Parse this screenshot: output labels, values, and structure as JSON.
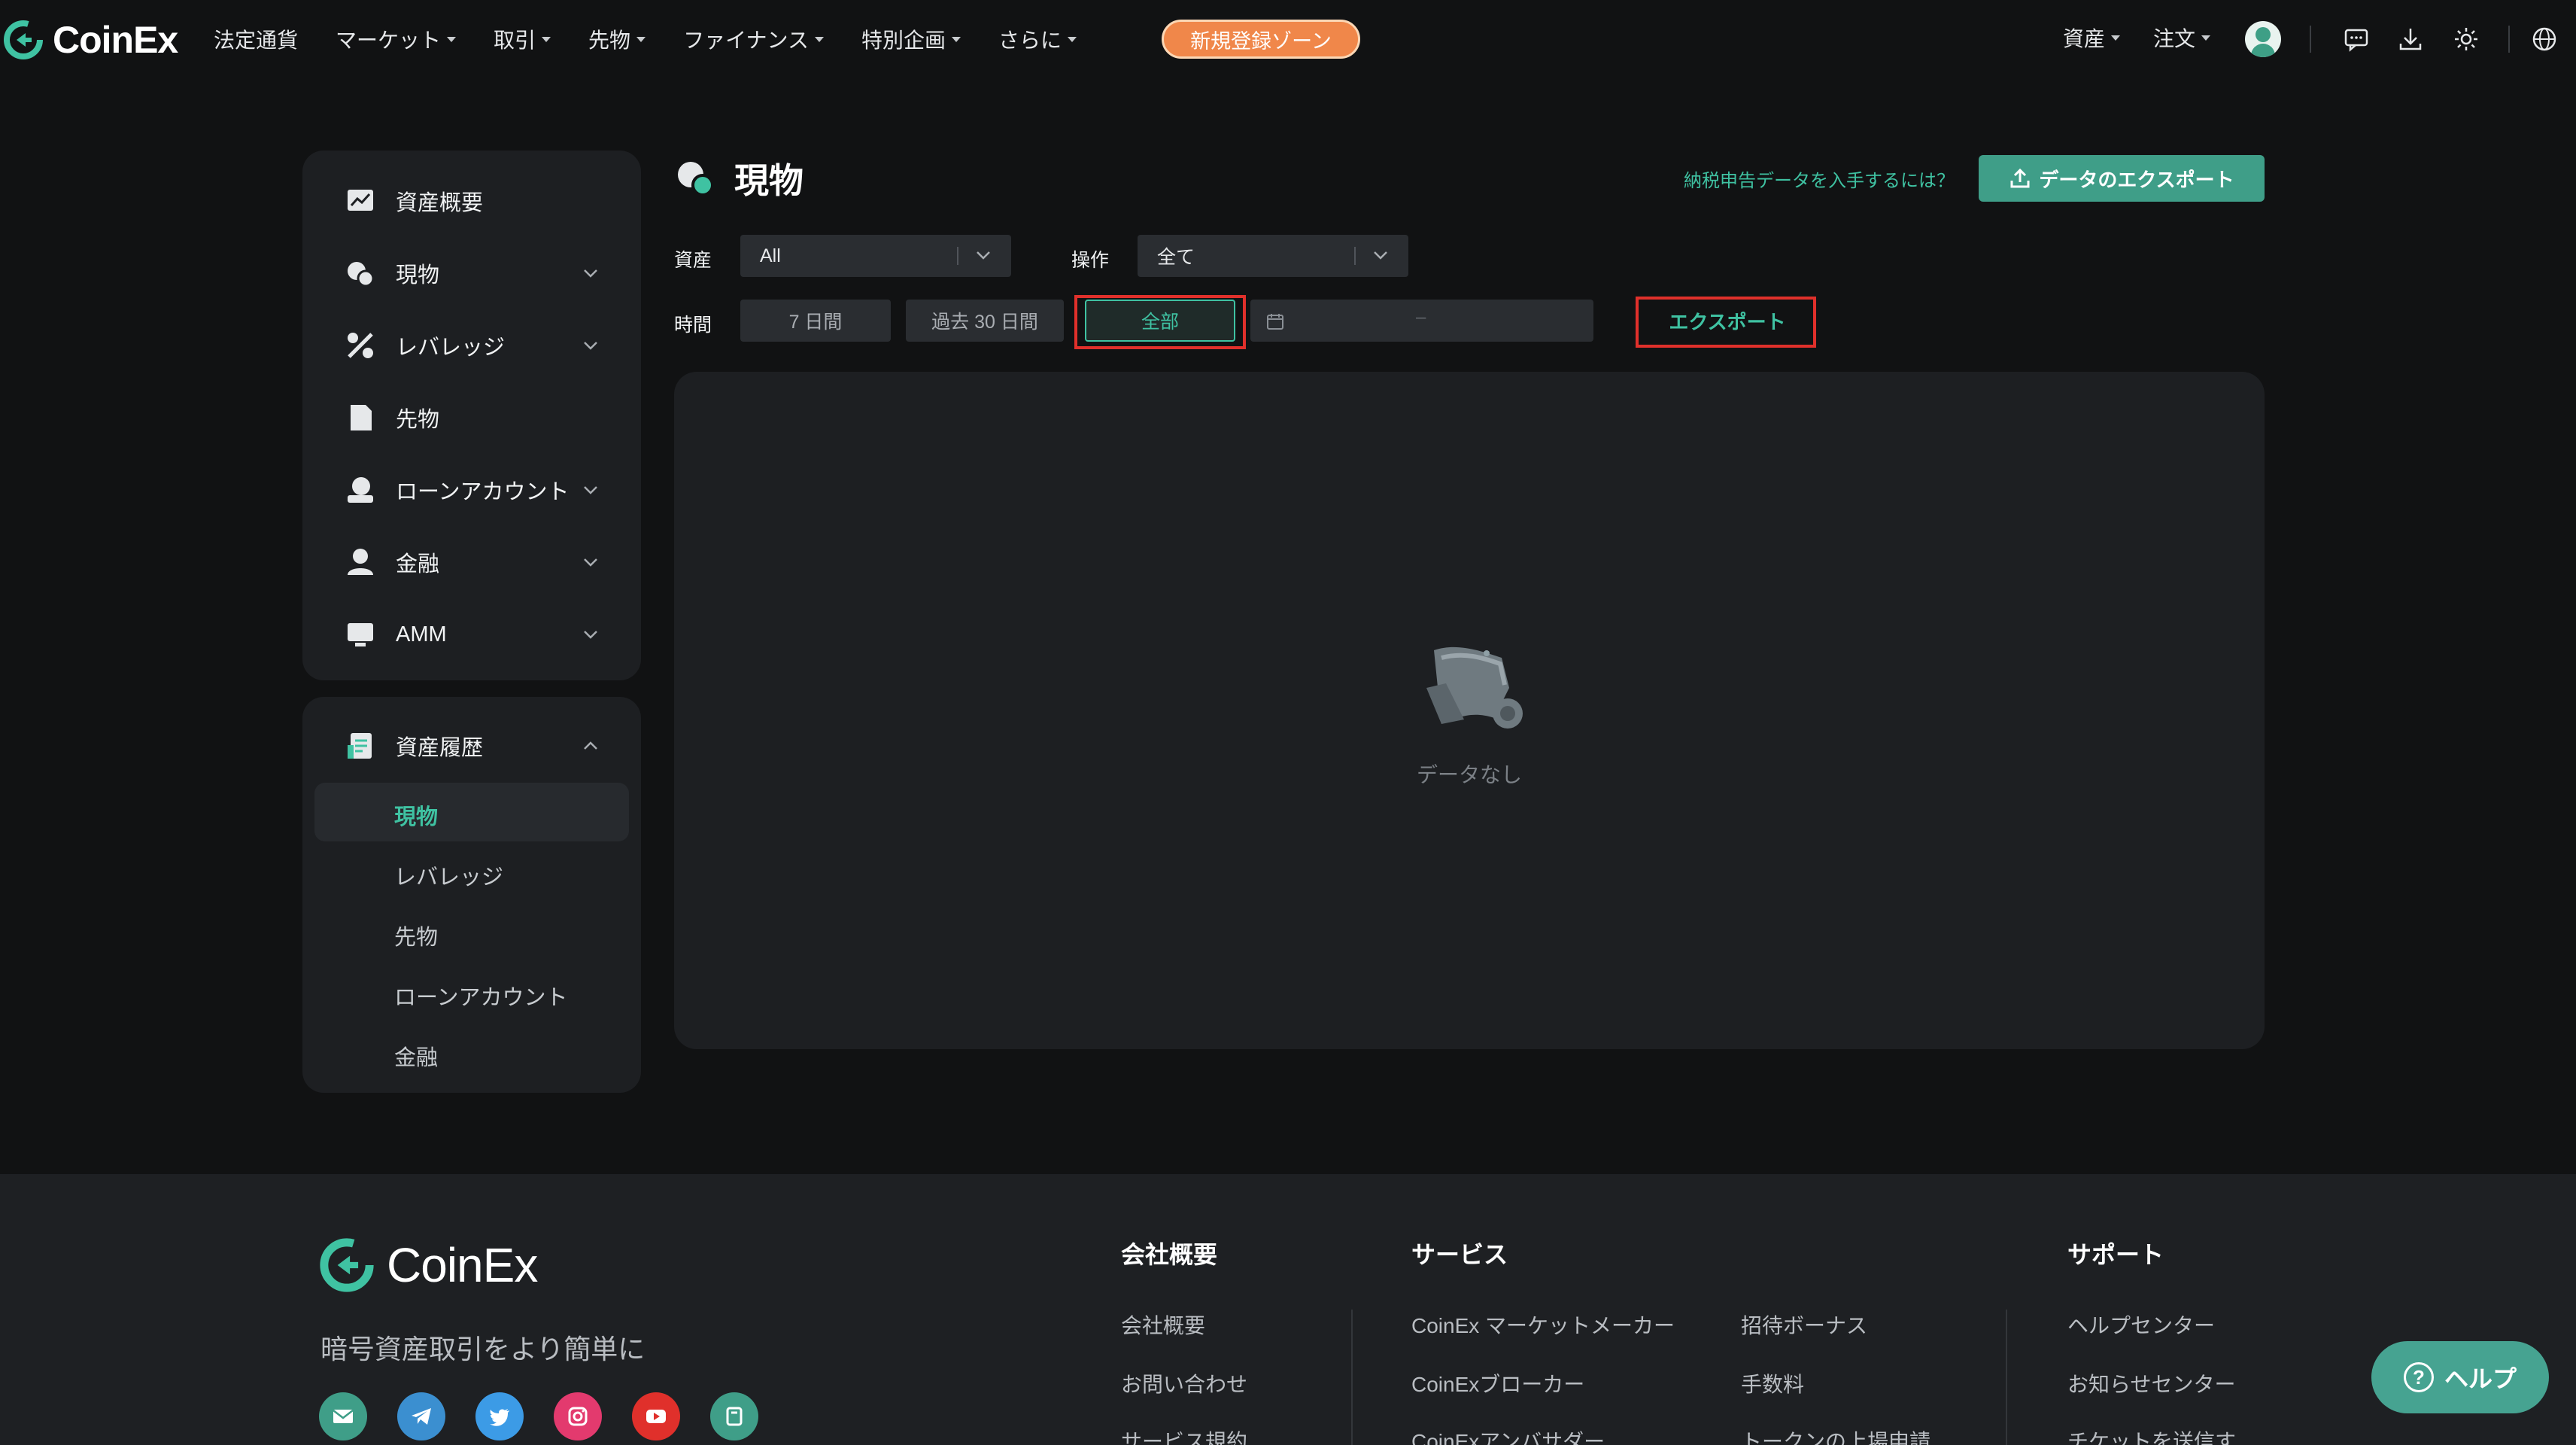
{
  "brand": {
    "name": "CoinEx",
    "accent": "#3fc2a2",
    "button_green": "#3f9e88",
    "promo_orange": "#f0874a"
  },
  "topnav": {
    "items": [
      {
        "label": "法定通貨",
        "dropdown": false
      },
      {
        "label": "マーケット",
        "dropdown": true
      },
      {
        "label": "取引",
        "dropdown": true
      },
      {
        "label": "先物",
        "dropdown": true
      },
      {
        "label": "ファイナンス",
        "dropdown": true
      },
      {
        "label": "特別企画",
        "dropdown": true
      },
      {
        "label": "さらに",
        "dropdown": true
      }
    ],
    "promo_label": "新規登録ゾーン",
    "assets_label": "資産",
    "orders_label": "注文",
    "icons": [
      "avatar",
      "message-icon",
      "download-icon",
      "theme-sun-icon",
      "globe-icon"
    ]
  },
  "sidebar": {
    "items": [
      {
        "label": "資産概要",
        "icon": "asset-overview-icon"
      },
      {
        "label": "現物",
        "icon": "spot-icon"
      },
      {
        "label": "レバレッジ",
        "icon": "margin-icon"
      },
      {
        "label": "先物",
        "icon": "futures-icon"
      },
      {
        "label": "ローンアカウント",
        "icon": "loan-icon"
      },
      {
        "label": "金融",
        "icon": "finance-icon"
      },
      {
        "label": "AMM",
        "icon": "amm-icon"
      }
    ],
    "history": {
      "label": "資産履歴",
      "sub_items": [
        "現物",
        "レバレッジ",
        "先物",
        "ローンアカウント",
        "金融"
      ],
      "active": "現物"
    }
  },
  "main": {
    "title": "現物",
    "tax_link": "納税申告データを入手するには？",
    "export_data_button": "データのエクスポート",
    "filters": {
      "asset_label": "資産",
      "asset_value": "All",
      "operation_label": "操作",
      "operation_value": "全て",
      "time_label": "時間",
      "time_options": [
        "7 日間",
        "過去 30 日間",
        "全部"
      ],
      "time_selected": "全部",
      "date_separator": "–",
      "export_button": "エクスポート"
    },
    "empty_text": "データなし"
  },
  "footer": {
    "logo": "CoinEx",
    "slogan": "暗号資産取引をより簡単に",
    "socials": [
      "email-icon",
      "telegram-icon",
      "twitter-icon",
      "instagram-icon",
      "youtube-icon",
      "medium-icon"
    ],
    "col_company": {
      "title": "会社概要",
      "links": [
        "会社概要",
        "お問い合わせ",
        "サービス規約"
      ]
    },
    "col_services": {
      "title": "サービス",
      "links": [
        "CoinEx マーケットメーカー",
        "CoinExブローカー",
        "CoinExアンバサダー"
      ],
      "links2": [
        "招待ボーナス",
        "手数料",
        "トークンの上場申請"
      ]
    },
    "col_support": {
      "title": "サポート",
      "links": [
        "ヘルプセンター",
        "お知らせセンター",
        "チケットを送信す"
      ]
    }
  },
  "help_button": "ヘルプ"
}
